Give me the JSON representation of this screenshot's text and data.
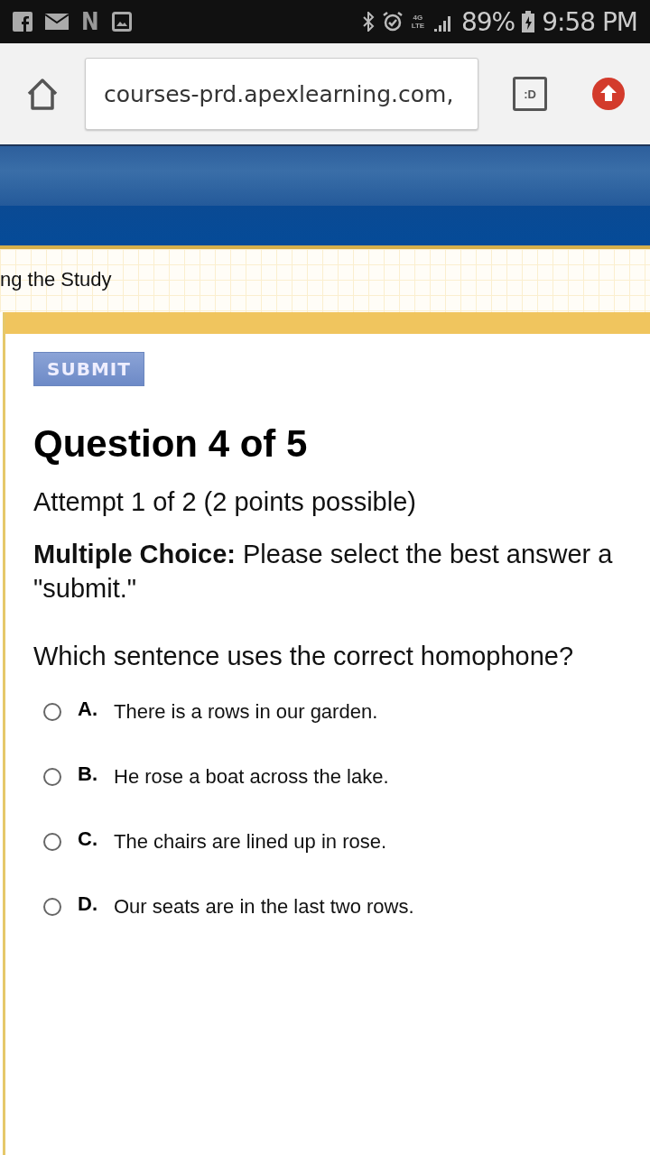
{
  "status_bar": {
    "notification_letter": "N",
    "network_label": "4G LTE",
    "battery": "89%",
    "time": "9:58 PM"
  },
  "browser": {
    "url": "courses-prd.apexlearning.com,",
    "extension_label": ":D"
  },
  "breadcrumb": "ng the Study",
  "quiz": {
    "submit": "SUBMIT",
    "title": "Question 4 of 5",
    "attempt": "Attempt 1 of 2 (2 points possible)",
    "instructions": [
      "**Multiple Choice:** Please select the best answer a",
      "\"submit.\""
    ],
    "question": "Which sentence uses the correct homophone?",
    "options": [
      {
        "letter": "A.",
        "text": "There is a rows in our garden.",
        "selected": false
      },
      {
        "letter": "B.",
        "text": "He rose a boat across the lake.",
        "selected": false
      },
      {
        "letter": "C.",
        "text": "The chairs are lined up in rose.",
        "selected": false
      },
      {
        "letter": "D.",
        "text": "Our seats are in the last two rows.",
        "selected": false
      }
    ]
  }
}
